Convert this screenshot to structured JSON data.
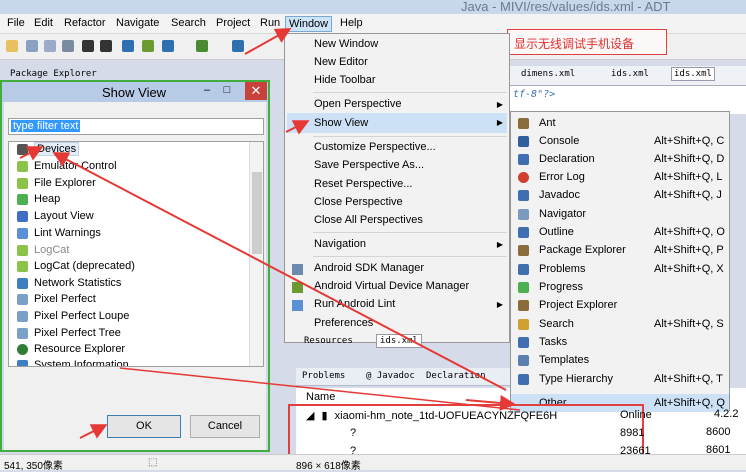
{
  "window_title": "Java - MIVI/res/values/ids.xml - ADT",
  "menubar": [
    "File",
    "Edit",
    "Refactor",
    "Navigate",
    "Search",
    "Project",
    "Run",
    "Window",
    "Help"
  ],
  "annotation": "显示无线调试手机设备",
  "editor_tabs": [
    "dimens.xml",
    "ids.xml",
    "ids.xml"
  ],
  "editor_code": "tf-8\"?>",
  "package_explorer_tab": "Package Explorer",
  "show_view": {
    "title": "Show View",
    "filter_placeholder": "type filter text",
    "items": [
      {
        "label": "Devices",
        "color": "#555555"
      },
      {
        "label": "Emulator Control",
        "color": "#8bc34a"
      },
      {
        "label": "File Explorer",
        "color": "#8bc34a"
      },
      {
        "label": "Heap",
        "color": "#4caf50"
      },
      {
        "label": "Layout View",
        "color": "#3f6fc4"
      },
      {
        "label": "Lint Warnings",
        "color": "#5b8fd6"
      },
      {
        "label": "LogCat",
        "color": "#8bc34a"
      },
      {
        "label": "LogCat (deprecated)",
        "color": "#8bc34a"
      },
      {
        "label": "Network Statistics",
        "color": "#3f7fbf"
      },
      {
        "label": "Pixel Perfect",
        "color": "#7aa0c8"
      },
      {
        "label": "Pixel Perfect Loupe",
        "color": "#7aa0c8"
      },
      {
        "label": "Pixel Perfect Tree",
        "color": "#7aa0c8"
      },
      {
        "label": "Resource Explorer",
        "color": "#2e7d32"
      },
      {
        "label": "System Information",
        "color": "#3f7fbf"
      }
    ],
    "ok": "OK",
    "cancel": "Cancel"
  },
  "window_menu": {
    "items": [
      "New Window",
      "New Editor",
      "Hide Toolbar",
      "Open Perspective",
      "Show View",
      "Customize Perspective...",
      "Save Perspective As...",
      "Reset Perspective...",
      "Close Perspective",
      "Close All Perspectives",
      "Navigation",
      "Android SDK Manager",
      "Android Virtual Device Manager",
      "Run Android Lint",
      "Preferences"
    ]
  },
  "show_view_submenu": [
    {
      "label": "Ant",
      "shortcut": "",
      "color": "#8a6d3b"
    },
    {
      "label": "Console",
      "shortcut": "Alt+Shift+Q, C",
      "color": "#2f5f9f"
    },
    {
      "label": "Declaration",
      "shortcut": "Alt+Shift+Q, D",
      "color": "#3f6fb0"
    },
    {
      "label": "Error Log",
      "shortcut": "Alt+Shift+Q, L",
      "color": "#d04030"
    },
    {
      "label": "Javadoc",
      "shortcut": "Alt+Shift+Q, J",
      "color": "#3f6fb0"
    },
    {
      "label": "Navigator",
      "shortcut": "",
      "color": "#7a9ac0"
    },
    {
      "label": "Outline",
      "shortcut": "Alt+Shift+Q, O",
      "color": "#3f6fb0"
    },
    {
      "label": "Package Explorer",
      "shortcut": "Alt+Shift+Q, P",
      "color": "#8a6d3b"
    },
    {
      "label": "Problems",
      "shortcut": "Alt+Shift+Q, X",
      "color": "#3f6fb0"
    },
    {
      "label": "Progress",
      "shortcut": "",
      "color": "#4caf50"
    },
    {
      "label": "Project Explorer",
      "shortcut": "",
      "color": "#8a6d3b"
    },
    {
      "label": "Search",
      "shortcut": "Alt+Shift+Q, S",
      "color": "#d0a030"
    },
    {
      "label": "Tasks",
      "shortcut": "",
      "color": "#3f6fb0"
    },
    {
      "label": "Templates",
      "shortcut": "",
      "color": "#5b7fb0"
    },
    {
      "label": "Type Hierarchy",
      "shortcut": "Alt+Shift+Q, T",
      "color": "#3f6fb0"
    },
    {
      "label": "Other...",
      "shortcut": "Alt+Shift+Q, Q",
      "color": "#f2f2f2"
    }
  ],
  "lower_tabs": [
    "Resources",
    "ids.xml"
  ],
  "bottom_tabs": [
    "Problems",
    "@ Javadoc",
    "Declaration"
  ],
  "table_header": "Name",
  "devices": [
    {
      "name": "xiaomi-hm_note_1td-UOFUEACYNZFQFE6H",
      "status": "Online",
      "version": "4.2.2"
    },
    {
      "name": "?",
      "status": "8981",
      "version": "8600"
    },
    {
      "name": "?",
      "status": "23661",
      "version": "8601"
    }
  ],
  "status": {
    "left": "541, 350像素",
    "right": "896 × 618像素"
  }
}
